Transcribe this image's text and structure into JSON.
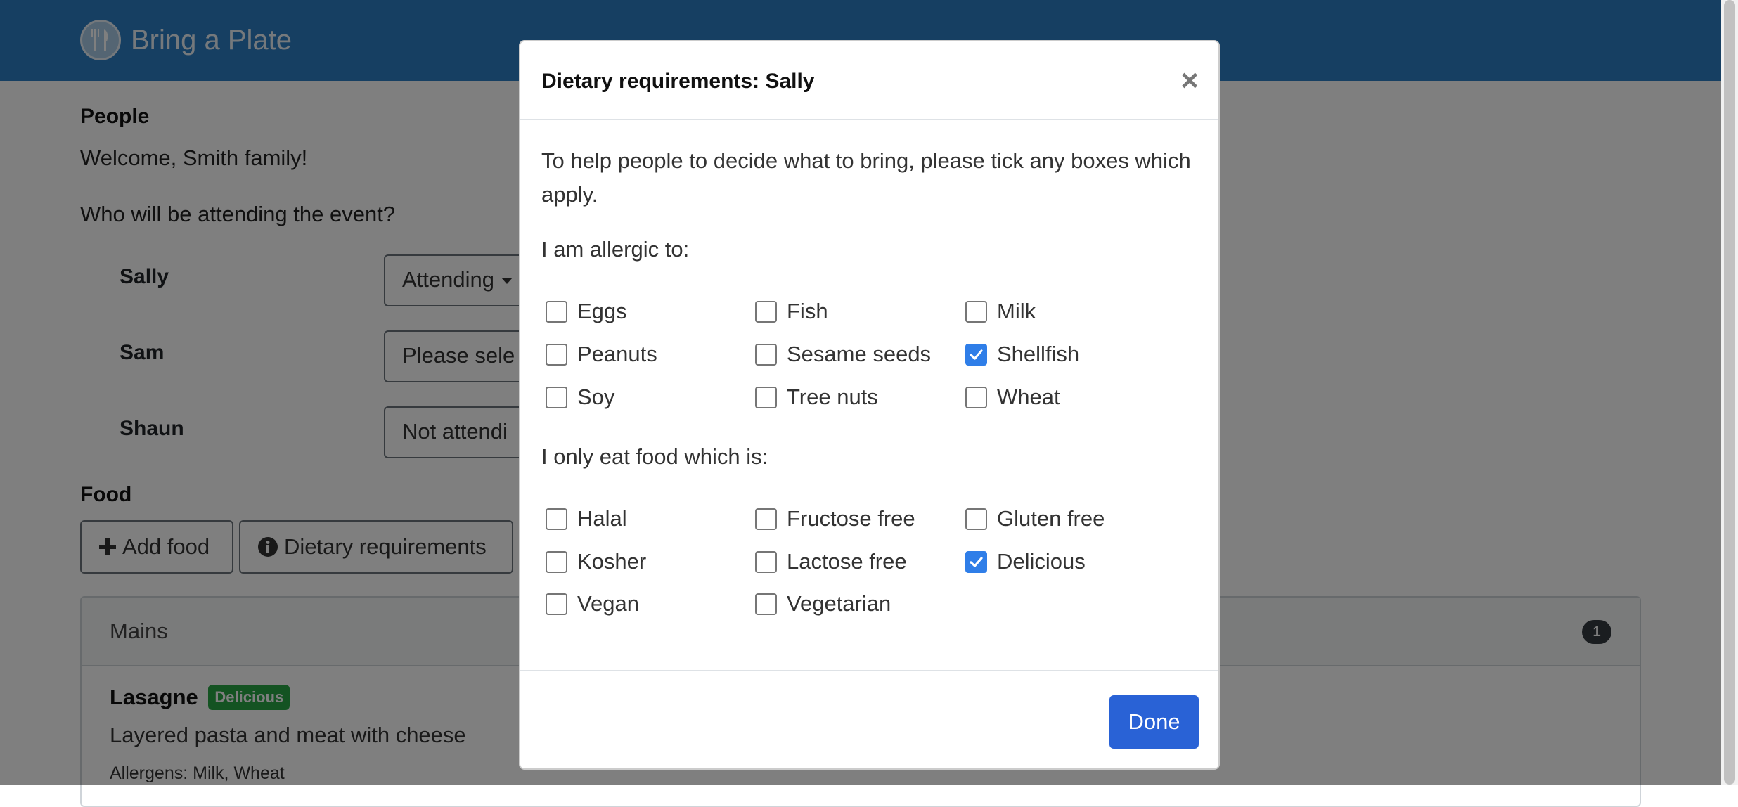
{
  "app": {
    "brand_name": "Bring a Plate",
    "logo_icon": "plate-cutlery-icon",
    "accent": "#2d7fc4"
  },
  "people": {
    "heading": "People",
    "welcome": "Welcome, Smith family!",
    "question": "Who will be attending the event?",
    "list": [
      {
        "name": "Sally",
        "status": "Attending"
      },
      {
        "name": "Sam",
        "status": "Please sele"
      },
      {
        "name": "Shaun",
        "status": "Not attendi"
      }
    ]
  },
  "food": {
    "heading": "Food",
    "add_food_label": "Add food",
    "dietary_label": "Dietary requirements",
    "category": {
      "name": "Mains",
      "count": "1"
    },
    "item": {
      "title": "Lasagne",
      "tag": "Delicious",
      "description": "Layered pasta and meat with cheese",
      "allergens": "Allergens: Milk, Wheat"
    }
  },
  "modal": {
    "title": "Dietary requirements: Sally",
    "close_symbol": "×",
    "intro": "To help people to decide what to bring, please tick any boxes which apply.",
    "allergic_label": "I am allergic to:",
    "allergies": [
      {
        "label": "Eggs",
        "checked": false
      },
      {
        "label": "Fish",
        "checked": false
      },
      {
        "label": "Milk",
        "checked": false
      },
      {
        "label": "Peanuts",
        "checked": false
      },
      {
        "label": "Sesame seeds",
        "checked": false
      },
      {
        "label": "Shellfish",
        "checked": true
      },
      {
        "label": "Soy",
        "checked": false
      },
      {
        "label": "Tree nuts",
        "checked": false
      },
      {
        "label": "Wheat",
        "checked": false
      }
    ],
    "diet_label": "I only eat food which is:",
    "diets": [
      {
        "label": "Halal",
        "checked": false
      },
      {
        "label": "Fructose free",
        "checked": false
      },
      {
        "label": "Gluten free",
        "checked": false
      },
      {
        "label": "Kosher",
        "checked": false
      },
      {
        "label": "Lactose free",
        "checked": false
      },
      {
        "label": "Delicious",
        "checked": true
      },
      {
        "label": "Vegan",
        "checked": false
      },
      {
        "label": "Vegetarian",
        "checked": false
      }
    ],
    "done_label": "Done"
  }
}
